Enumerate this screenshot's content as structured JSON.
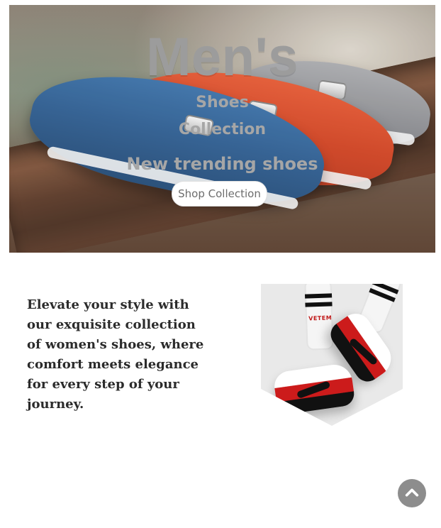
{
  "hero": {
    "title": "Men's",
    "line_1": "Shoes",
    "line_2": "Collection",
    "line_3": "New trending shoes",
    "cta": "Shop Collection"
  },
  "content": {
    "tagline": "Elevate your style with our exquisite collection of women's shoes, where comfort meets elegance for every step of your journey."
  },
  "promo_image": {
    "sock_brand_text": "VETEM"
  },
  "icons": {
    "back_to_top": "chevron-up-icon"
  },
  "colors": {
    "hero_text": "#9c9c9c",
    "button_text": "#6d6d6d",
    "back_to_top_bg": "#8d8d8d",
    "tagline_text": "#2b2b2b",
    "accent_red": "#cc1b1b"
  }
}
